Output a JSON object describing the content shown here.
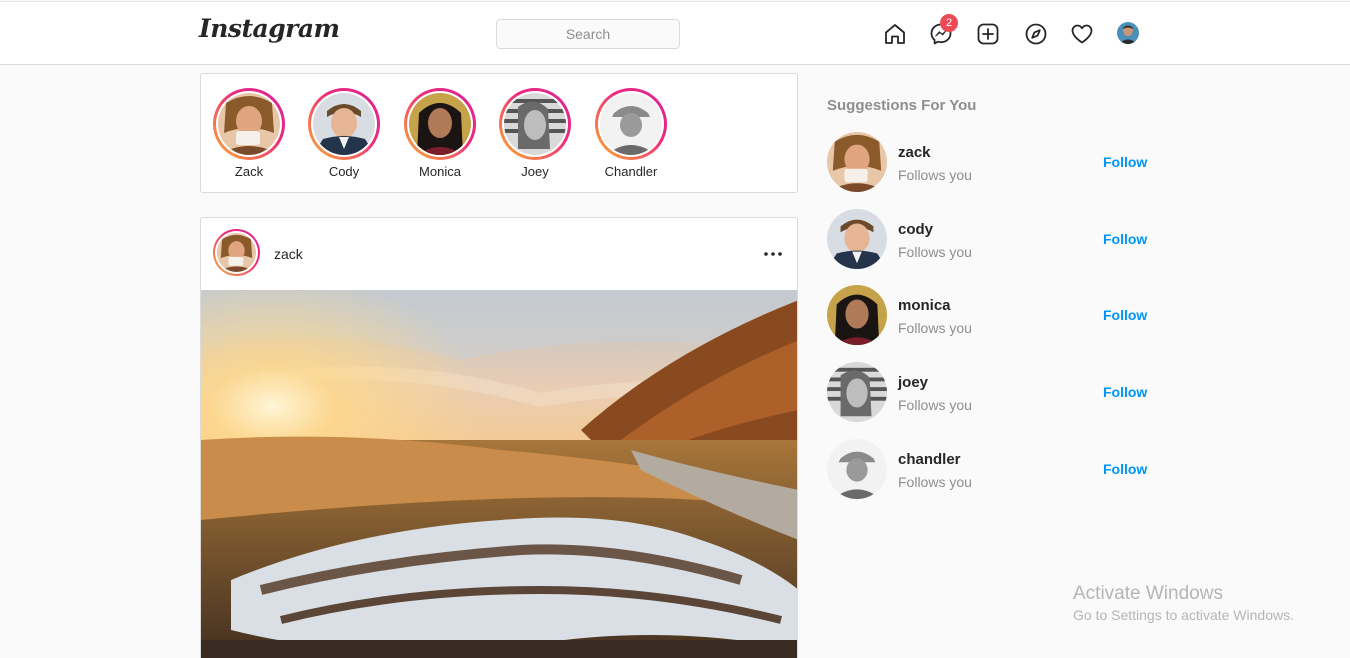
{
  "header": {
    "logo": "Instagram",
    "search_placeholder": "Search",
    "messages_badge": "2",
    "icons": [
      "home-icon",
      "messenger-icon",
      "new-post-icon",
      "explore-icon",
      "activity-heart-icon",
      "profile-avatar"
    ]
  },
  "stories": [
    {
      "name": "Zack"
    },
    {
      "name": "Cody"
    },
    {
      "name": "Monica"
    },
    {
      "name": "Joey"
    },
    {
      "name": "Chandler"
    }
  ],
  "post": {
    "username": "zack",
    "menu_icon": "more-options-icon"
  },
  "suggestions": {
    "title": "Suggestions For You",
    "items": [
      {
        "username": "zack",
        "subtitle": "Follows you",
        "action": "Follow"
      },
      {
        "username": "cody",
        "subtitle": "Follows you",
        "action": "Follow"
      },
      {
        "username": "monica",
        "subtitle": "Follows you",
        "action": "Follow"
      },
      {
        "username": "joey",
        "subtitle": "Follows you",
        "action": "Follow"
      },
      {
        "username": "chandler",
        "subtitle": "Follows you",
        "action": "Follow"
      }
    ]
  },
  "watermark": {
    "title": "Activate Windows",
    "subtitle": "Go to Settings to activate Windows."
  },
  "colors": {
    "accent": "#0095f6",
    "badge": "#ed4956",
    "story_ring_start": "#f9b233",
    "story_ring_end": "#d6249f"
  }
}
